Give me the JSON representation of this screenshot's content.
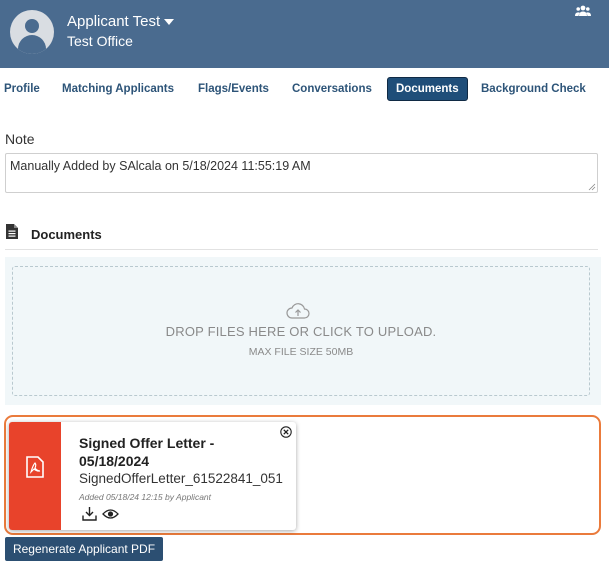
{
  "header": {
    "user_name": "Applicant Test",
    "office": "Test Office",
    "bg_color": "#4a6b8f",
    "icons": [
      "avatar-icon",
      "caret-down-icon",
      "users-icon"
    ]
  },
  "tabs": [
    {
      "label": "Profile"
    },
    {
      "label": "Matching Applicants"
    },
    {
      "label": "Flags/Events"
    },
    {
      "label": "Conversations"
    },
    {
      "label": "Documents",
      "active": true
    },
    {
      "label": "Background Check"
    }
  ],
  "note": {
    "label": "Note",
    "value": "Manually Added by SAlcala on 5/18/2024 11:55:19 AM"
  },
  "documents": {
    "title": "Documents",
    "dropzone": {
      "text": "DROP FILES HERE OR CLICK TO UPLOAD.",
      "subtext": "MAX FILE SIZE 50MB"
    },
    "files": [
      {
        "title": "Signed Offer Letter - 05/18/2024",
        "filename": "SignedOfferLetter_61522841_051",
        "meta": "Added 05/18/24 12:15 by Applicant",
        "type_color": "#e8432b"
      }
    ]
  },
  "actions": {
    "regenerate_label": "Regenerate Applicant PDF"
  },
  "colors": {
    "accent": "#1f4e79",
    "highlight": "#ea7b3c"
  }
}
